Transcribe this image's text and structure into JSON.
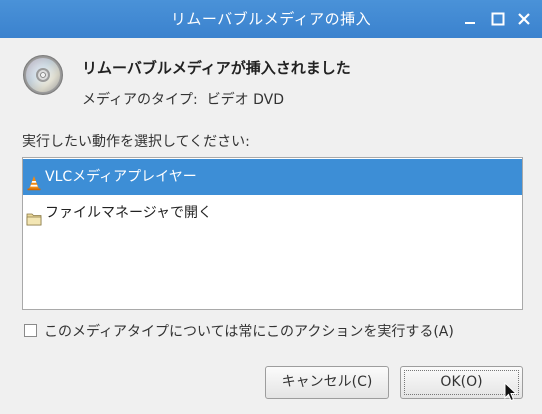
{
  "window": {
    "title": "リムーバブルメディアの挿入"
  },
  "header": {
    "heading": "リムーバブルメディアが挿入されました",
    "media_type_label": "メディアのタイプ:",
    "media_type_value": "ビデオ DVD"
  },
  "prompt": "実行したい動作を選択してください:",
  "actions": [
    {
      "label": "VLCメディアプレイヤー",
      "icon": "vlc-cone-icon",
      "selected": true
    },
    {
      "label": "ファイルマネージャで開く",
      "icon": "folder-icon",
      "selected": false
    }
  ],
  "always_checkbox": {
    "label": "このメディアタイプについては常にこのアクションを実行する(A)",
    "checked": false
  },
  "buttons": {
    "cancel": "キャンセル(C)",
    "ok": "OK(O)"
  },
  "colors": {
    "titlebar": "#3b82ce",
    "selection": "#3d8ed6",
    "background": "#f0f0f0"
  }
}
